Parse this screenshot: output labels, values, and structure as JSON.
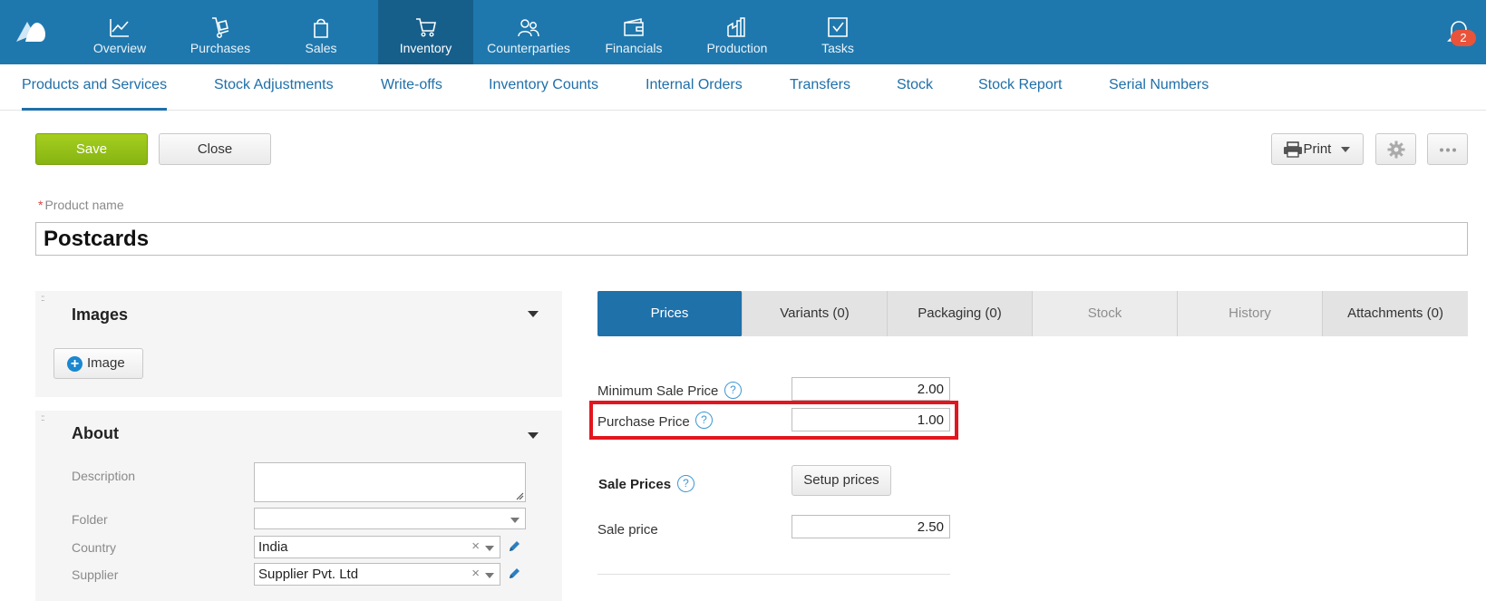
{
  "app": {
    "logo": "moysklad-logo",
    "nav": [
      {
        "label": "Overview",
        "icon": "chart-line-icon"
      },
      {
        "label": "Purchases",
        "icon": "hand-truck-icon"
      },
      {
        "label": "Sales",
        "icon": "shopping-bag-icon"
      },
      {
        "label": "Inventory",
        "icon": "shopping-cart-icon",
        "active": true
      },
      {
        "label": "Counterparties",
        "icon": "people-icon"
      },
      {
        "label": "Financials",
        "icon": "wallet-icon"
      },
      {
        "label": "Production",
        "icon": "factory-icon"
      },
      {
        "label": "Tasks",
        "icon": "task-check-icon"
      }
    ],
    "notifications_count": "2"
  },
  "subnav": [
    {
      "label": "Products and Services",
      "active": true
    },
    {
      "label": "Stock Adjustments"
    },
    {
      "label": "Write-offs"
    },
    {
      "label": "Inventory Counts"
    },
    {
      "label": "Internal Orders"
    },
    {
      "label": "Transfers"
    },
    {
      "label": "Stock"
    },
    {
      "label": "Stock Report"
    },
    {
      "label": "Serial Numbers"
    }
  ],
  "toolbar": {
    "save_label": "Save",
    "close_label": "Close",
    "print_label": "Print"
  },
  "product": {
    "required_mark": "*",
    "name_label": "Product name",
    "name_value": "Postcards"
  },
  "images_panel": {
    "title": "Images",
    "add_image_label": "Image"
  },
  "about_panel": {
    "title": "About",
    "description_label": "Description",
    "description_value": "",
    "folder_label": "Folder",
    "folder_value": "",
    "country_label": "Country",
    "country_value": "India",
    "supplier_label": "Supplier",
    "supplier_value": "Supplier Pvt. Ltd"
  },
  "tabs": [
    {
      "label": "Prices",
      "state": "active"
    },
    {
      "label": "Variants (0)",
      "state": "normal"
    },
    {
      "label": "Packaging (0)",
      "state": "normal"
    },
    {
      "label": "Stock",
      "state": "muted"
    },
    {
      "label": "History",
      "state": "muted"
    },
    {
      "label": "Attachments (0)",
      "state": "normal"
    }
  ],
  "prices": {
    "min_sale_label": "Minimum Sale Price",
    "min_sale_value": "2.00",
    "purchase_label": "Purchase Price",
    "purchase_value": "1.00",
    "sale_prices_label": "Sale Prices",
    "setup_prices_label": "Setup prices",
    "sale_price_label": "Sale price",
    "sale_price_value": "2.50",
    "help_glyph": "?"
  },
  "colors": {
    "brand_blue": "#1f78ad",
    "save_green": "#98c21a",
    "highlight_red": "#e1161e"
  }
}
